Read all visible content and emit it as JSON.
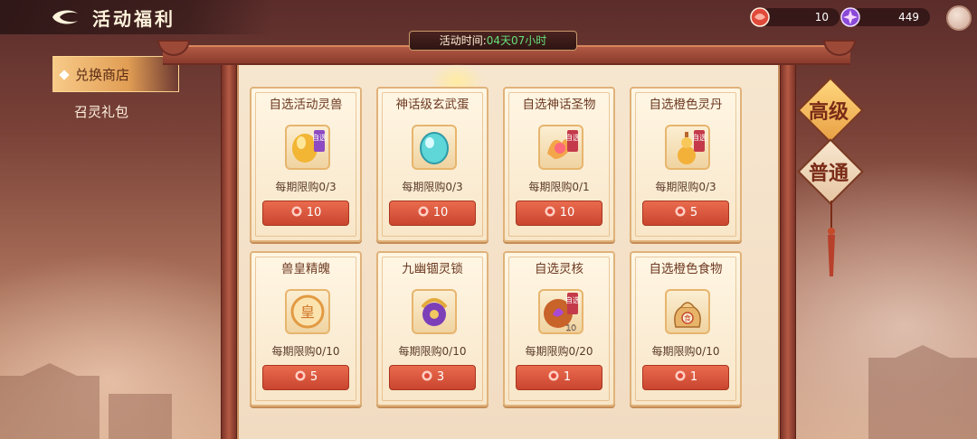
{
  "header": {
    "title": "活动福利",
    "currency_red": "10",
    "currency_purple": "449"
  },
  "timer": {
    "label": "活动时间:",
    "value": "04天07小时"
  },
  "side_menu": [
    {
      "label": "兑换商店",
      "active": true
    },
    {
      "label": "召灵礼包",
      "active": false
    }
  ],
  "grade_tabs": [
    {
      "label": "高级",
      "active": true
    },
    {
      "label": "普通",
      "active": false
    }
  ],
  "items": [
    {
      "name": "自选活动灵兽",
      "limit": "每期限购0/3",
      "price": "10",
      "icon": "golden-beast-egg-icon",
      "badge": "自选"
    },
    {
      "name": "神话级玄武蛋",
      "limit": "每期限购0/3",
      "price": "10",
      "icon": "cyan-egg-icon",
      "badge": ""
    },
    {
      "name": "自选神话圣物",
      "limit": "每期限购0/1",
      "price": "10",
      "icon": "sacred-relic-icon",
      "badge": "自选"
    },
    {
      "name": "自选橙色灵丹",
      "limit": "每期限购0/3",
      "price": "5",
      "icon": "elixir-gourd-icon",
      "badge": "自选"
    },
    {
      "name": "兽皇精魄",
      "limit": "每期限购0/10",
      "price": "5",
      "icon": "beast-king-soul-icon",
      "badge": "皇"
    },
    {
      "name": "九幽锢灵锁",
      "limit": "每期限购0/10",
      "price": "3",
      "icon": "spirit-lock-icon",
      "badge": ""
    },
    {
      "name": "自选灵核",
      "limit": "每期限购0/20",
      "price": "1",
      "icon": "spirit-core-icon",
      "badge": "自选",
      "count": "10"
    },
    {
      "name": "自选橙色食物",
      "limit": "每期限购0/10",
      "price": "1",
      "icon": "food-bag-icon",
      "badge": "食"
    }
  ],
  "colors": {
    "accent_red": "#c9452f",
    "timer_green": "#66e07a",
    "panel_bg": "#f7e6cf"
  }
}
